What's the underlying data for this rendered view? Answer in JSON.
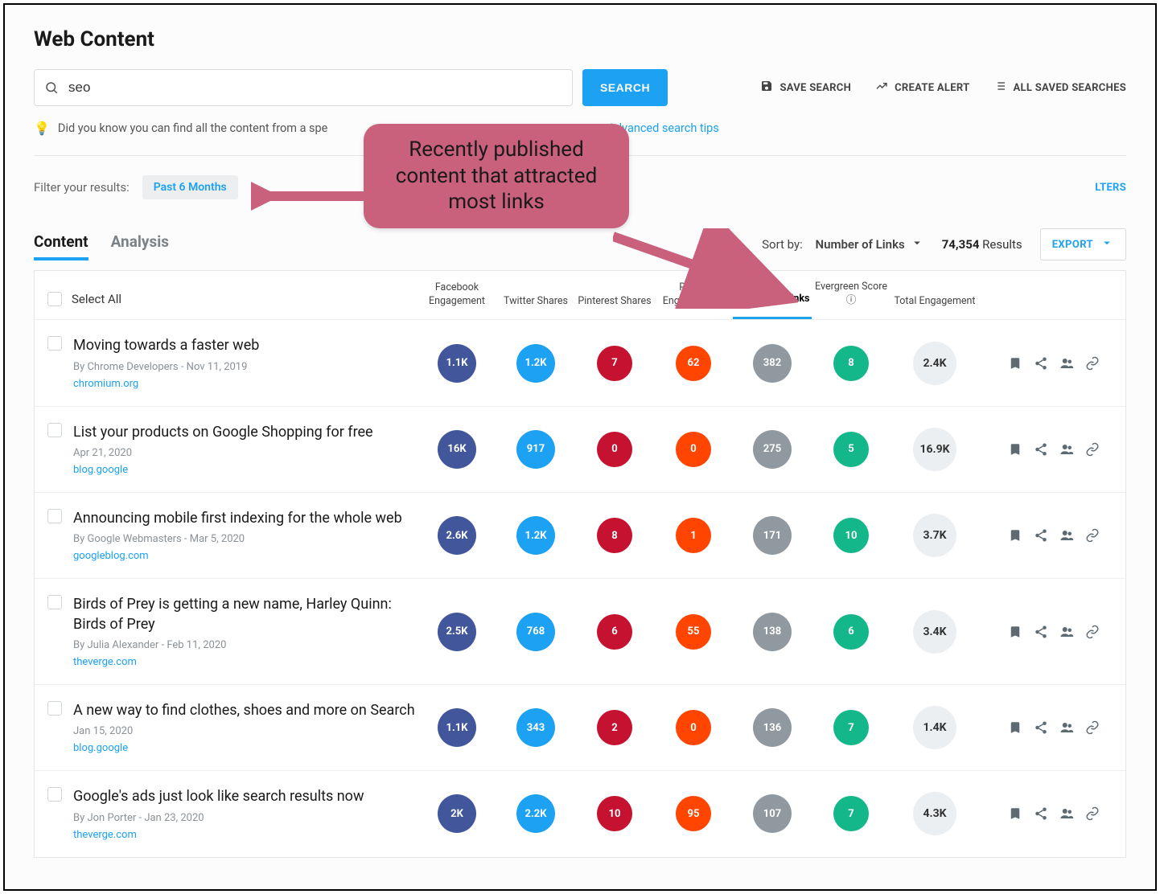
{
  "page": {
    "title": "Web Content"
  },
  "search": {
    "value": "seo",
    "button": "SEARCH",
    "tip_prefix": "Did you know you can find all the content from a spe",
    "advanced": "Advanced search tips"
  },
  "top_actions": {
    "save": "SAVE SEARCH",
    "alert": "CREATE ALERT",
    "all_saved": "ALL SAVED SEARCHES"
  },
  "filters": {
    "label": "Filter your results:",
    "chip": "Past 6 Months",
    "link": "LTERS"
  },
  "callout": "Recently published content that attracted most links",
  "tabs": {
    "content": "Content",
    "analysis": "Analysis"
  },
  "sort": {
    "label": "Sort by:",
    "value": "Number of Links"
  },
  "results": {
    "count": "74,354",
    "label": "Results"
  },
  "export_label": "EXPORT",
  "columns": {
    "select_all": "Select All",
    "facebook": "Facebook Engagement",
    "twitter": "Twitter Shares",
    "pinterest": "Pinterest Shares",
    "reddit": "Reddit Engagements",
    "links": "Number of Links",
    "evergreen": "Evergreen Score",
    "total": "Total Engagement"
  },
  "rows": [
    {
      "title": "Moving towards a faster web",
      "byline": "By Chrome Developers - Nov 11, 2019",
      "domain": "chromium.org",
      "fb": "1.1K",
      "tw": "1.2K",
      "pn": "7",
      "rd": "62",
      "ln": "382",
      "ev": "8",
      "tot": "2.4K"
    },
    {
      "title": "List your products on Google Shopping for free",
      "byline": "Apr 21, 2020",
      "domain": "blog.google",
      "fb": "16K",
      "tw": "917",
      "pn": "0",
      "rd": "0",
      "ln": "275",
      "ev": "5",
      "tot": "16.9K"
    },
    {
      "title": "Announcing mobile first indexing for the whole web",
      "byline": "By Google Webmasters - Mar 5, 2020",
      "domain": "googleblog.com",
      "fb": "2.6K",
      "tw": "1.2K",
      "pn": "8",
      "rd": "1",
      "ln": "171",
      "ev": "10",
      "tot": "3.7K"
    },
    {
      "title": "Birds of Prey is getting a new name, Harley Quinn: Birds of Prey",
      "byline": "By Julia Alexander - Feb 11, 2020",
      "domain": "theverge.com",
      "fb": "2.5K",
      "tw": "768",
      "pn": "6",
      "rd": "55",
      "ln": "138",
      "ev": "6",
      "tot": "3.4K"
    },
    {
      "title": "A new way to find clothes, shoes and more on Search",
      "byline": "Jan 15, 2020",
      "domain": "blog.google",
      "fb": "1.1K",
      "tw": "343",
      "pn": "2",
      "rd": "0",
      "ln": "136",
      "ev": "7",
      "tot": "1.4K"
    },
    {
      "title": "Google's ads just look like search results now",
      "byline": "By Jon Porter - Jan 23, 2020",
      "domain": "theverge.com",
      "fb": "2K",
      "tw": "2.2K",
      "pn": "10",
      "rd": "95",
      "ln": "107",
      "ev": "7",
      "tot": "4.3K"
    }
  ]
}
